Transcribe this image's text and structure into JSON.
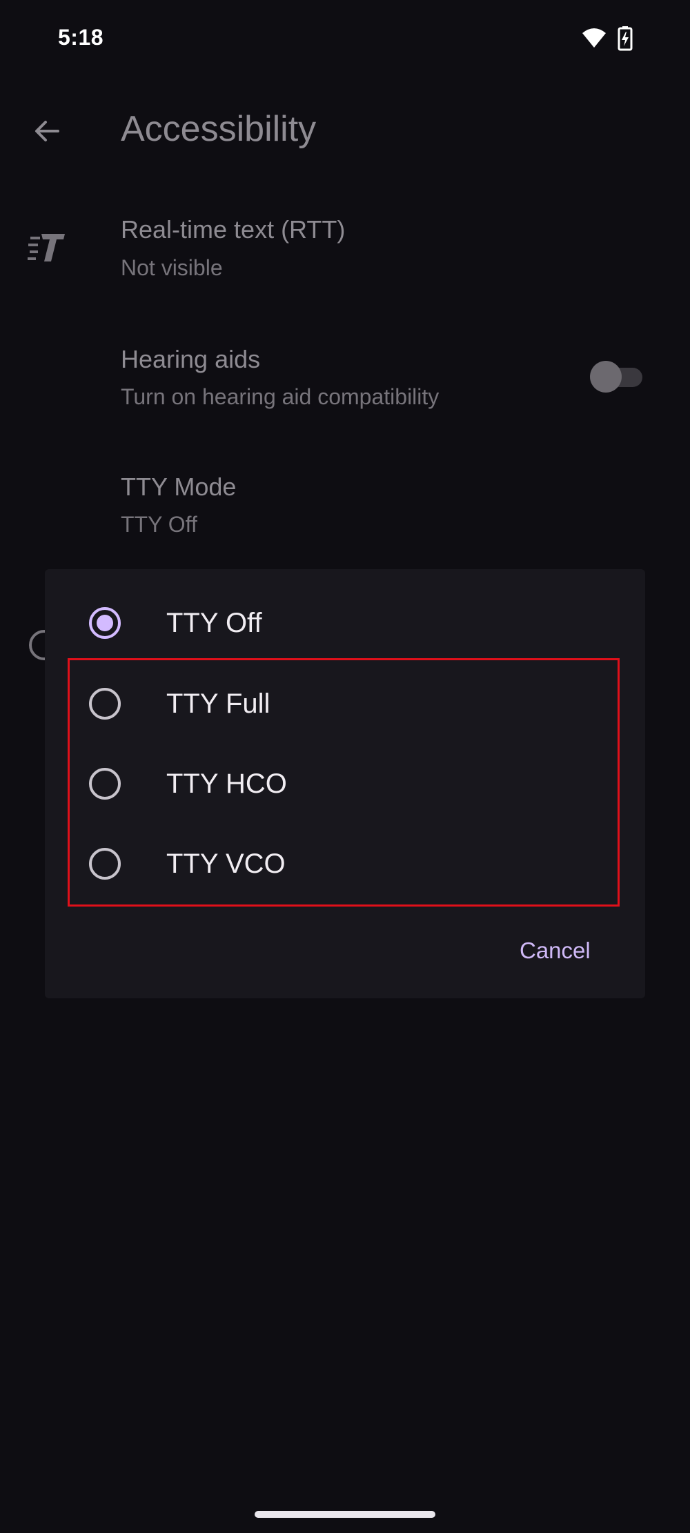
{
  "status_bar": {
    "time": "5:18",
    "icons": [
      "wifi-icon",
      "battery-charging-icon"
    ]
  },
  "header": {
    "title": "Accessibility",
    "back_icon": "back-arrow-icon"
  },
  "settings": {
    "rtt": {
      "icon": "rtt-icon",
      "title": "Real-time text (RTT)",
      "subtitle": "Not visible"
    },
    "hearing_aids": {
      "title": "Hearing aids",
      "subtitle": "Turn on hearing aid compatibility",
      "toggle_on": false
    },
    "tty_mode": {
      "title": "TTY Mode",
      "subtitle": "TTY Off"
    }
  },
  "dialog": {
    "options": [
      {
        "label": "TTY Off",
        "selected": true
      },
      {
        "label": "TTY Full",
        "selected": false
      },
      {
        "label": "TTY HCO",
        "selected": false
      },
      {
        "label": "TTY VCO",
        "selected": false
      }
    ],
    "cancel_label": "Cancel"
  },
  "colors": {
    "background": "#0e0d12",
    "dialog_bg": "#18171d",
    "accent": "#d3bbff",
    "highlight": "#e0101a"
  }
}
